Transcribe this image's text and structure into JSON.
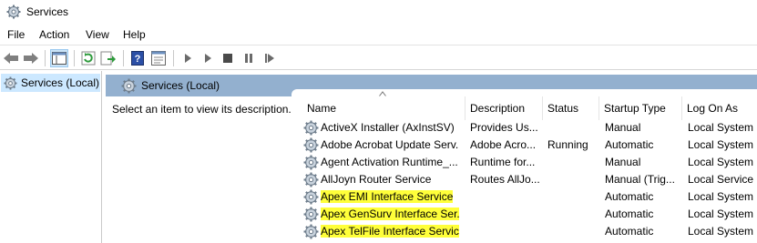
{
  "window": {
    "title": "Services"
  },
  "menu": [
    "File",
    "Action",
    "View",
    "Help"
  ],
  "tree": {
    "selected_label": "Services (Local)"
  },
  "pane": {
    "header_label": "Services (Local)",
    "description_prompt": "Select an item to view its description."
  },
  "table": {
    "columns": [
      "Name",
      "Description",
      "Status",
      "Startup Type",
      "Log On As"
    ],
    "rows": [
      {
        "name": "ActiveX Installer (AxInstSV)",
        "description": "Provides Us...",
        "status": "",
        "startup": "Manual",
        "logon": "Local System",
        "highlighted": false
      },
      {
        "name": "Adobe Acrobat Update Serv...",
        "description": "Adobe Acro...",
        "status": "Running",
        "startup": "Automatic",
        "logon": "Local System",
        "highlighted": false
      },
      {
        "name": "Agent Activation Runtime_...",
        "description": "Runtime for...",
        "status": "",
        "startup": "Manual",
        "logon": "Local System",
        "highlighted": false
      },
      {
        "name": "AllJoyn Router Service",
        "description": "Routes AllJo...",
        "status": "",
        "startup": "Manual (Trig...",
        "logon": "Local Service",
        "highlighted": false
      },
      {
        "name": "Apex EMI Interface Service",
        "description": "",
        "status": "",
        "startup": "Automatic",
        "logon": "Local System",
        "highlighted": true
      },
      {
        "name": "Apex GenSurv Interface Ser...",
        "description": "",
        "status": "",
        "startup": "Automatic",
        "logon": "Local System",
        "highlighted": true
      },
      {
        "name": "Apex TelFile Interface Service",
        "description": "",
        "status": "",
        "startup": "Automatic",
        "logon": "Local System",
        "highlighted": true
      }
    ]
  },
  "colors": {
    "pane_header": "#93b0cf",
    "tree_selection": "#cce8ff",
    "highlight": "#ffff3a"
  }
}
